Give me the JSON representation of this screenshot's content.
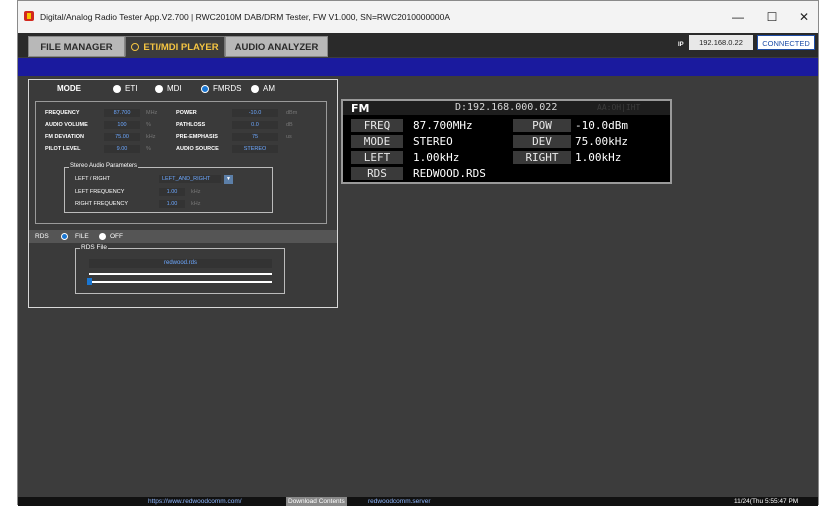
{
  "window": {
    "title": "Digital/Analog Radio Tester App.V2.700 | RWC2010M DAB/DRM Tester, FW V1.000, SN=RWC2010000000A",
    "minimize": "—",
    "maximize": "☐",
    "close": "✕"
  },
  "tabs": [
    {
      "label": "FILE MANAGER"
    },
    {
      "label": "ETI/MDI PLAYER"
    },
    {
      "label": "AUDIO ANALYZER"
    }
  ],
  "connection": {
    "ip_label": "IP",
    "ip": "192.168.0.22",
    "status": "CONNECTED"
  },
  "mode": {
    "label": "MODE",
    "options": [
      "ETI",
      "MDI",
      "FMRDS",
      "AM"
    ],
    "selected": "FMRDS"
  },
  "params": {
    "frequency": {
      "label": "FREQUENCY",
      "value": "87.700",
      "unit": "MHz"
    },
    "audio_volume": {
      "label": "AUDIO VOLUME",
      "value": "100",
      "unit": "%"
    },
    "fm_deviation": {
      "label": "FM DEVIATION",
      "value": "75.00",
      "unit": "kHz"
    },
    "pilot_level": {
      "label": "PILOT LEVEL",
      "value": "9.00",
      "unit": "%"
    },
    "power": {
      "label": "POWER",
      "value": "-10.0",
      "unit": "dBm"
    },
    "pathloss": {
      "label": "PATHLOSS",
      "value": "0.0",
      "unit": "dB"
    },
    "pre_emphasis": {
      "label": "PRE-EMPHASIS",
      "value": "75",
      "unit": "us"
    },
    "audio_source": {
      "label": "AUDIO SOURCE",
      "value": "STEREO"
    }
  },
  "stereo": {
    "group_label": "Stereo Audio Parameters",
    "left_right_label": "LEFT / RIGHT",
    "left_right_value": "LEFT_AND_RIGHT",
    "left_freq_label": "LEFT FREQUENCY",
    "left_freq_value": "1.00",
    "left_freq_unit": "kHz",
    "right_freq_label": "RIGHT FREQUENCY",
    "right_freq_value": "1.00",
    "right_freq_unit": "kHz"
  },
  "rds": {
    "label": "RDS",
    "options": [
      "FILE",
      "OFF"
    ],
    "selected": "FILE",
    "group_label": "RDS File",
    "file_name": "redwood.rds",
    "progress": 0.0
  },
  "lcd": {
    "band": "FM",
    "ip_text": "D:192.168.000.022",
    "ghost_text": "AA:OH|IHT",
    "rows": [
      {
        "label1": "FREQ",
        "value1": "87.700MHz",
        "label2": "POW",
        "value2": "-10.0dBm"
      },
      {
        "label1": "MODE",
        "value1": "STEREO",
        "label2": "DEV",
        "value2": "75.00kHz"
      },
      {
        "label1": "LEFT",
        "value1": "1.00kHz",
        "label2": "RIGHT",
        "value2": "1.00kHz"
      },
      {
        "label1": "RDS",
        "value1": "REDWOOD.RDS",
        "label2": "",
        "value2": ""
      }
    ]
  },
  "status": {
    "url": "https://www.redwoodcomm.com/",
    "download": "Download Contents",
    "server": "redwoodcomm.server",
    "datetime": "11/24(Thu 5:55:47 PM"
  }
}
